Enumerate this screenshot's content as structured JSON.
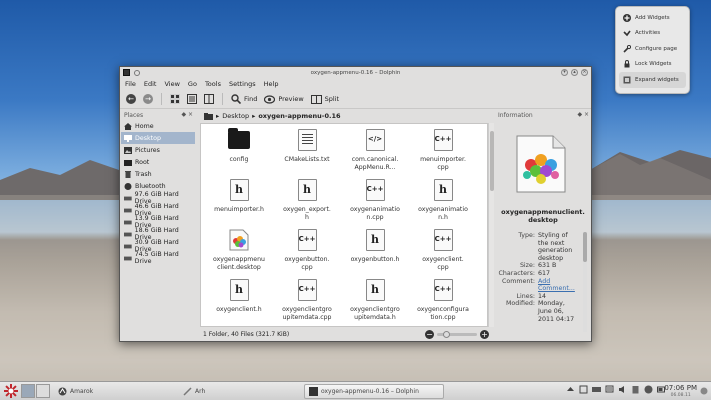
{
  "toolbox": {
    "items": [
      {
        "label": "Add Widgets",
        "icon": "plus-icon"
      },
      {
        "label": "Activities",
        "icon": "activities-icon"
      },
      {
        "label": "Configure page",
        "icon": "wrench-icon"
      },
      {
        "label": "Lock Widgets",
        "icon": "lock-icon"
      },
      {
        "label": "Expand widgets",
        "icon": "expand-icon"
      }
    ]
  },
  "window": {
    "title": "oxygen-appmenu-0.16 – Dolphin",
    "menu": [
      "File",
      "Edit",
      "View",
      "Go",
      "Tools",
      "Settings",
      "Help"
    ],
    "toolbar": {
      "find": "Find",
      "preview": "Preview",
      "split": "Split"
    }
  },
  "places": {
    "header": "Places",
    "items": [
      {
        "label": "Home",
        "icon": "home-icon"
      },
      {
        "label": "Desktop",
        "icon": "desktop-icon"
      },
      {
        "label": "Pictures",
        "icon": "pictures-icon"
      },
      {
        "label": "Root",
        "icon": "root-icon"
      },
      {
        "label": "Trash",
        "icon": "trash-icon"
      },
      {
        "label": "Bluetooth",
        "icon": "bluetooth-icon"
      },
      {
        "label": "97.6 GiB Hard Drive",
        "icon": "harddrive-icon"
      },
      {
        "label": "46.6 GiB Hard Drive",
        "icon": "harddrive-icon"
      },
      {
        "label": "13.9 GiB Hard Drive",
        "icon": "harddrive-icon"
      },
      {
        "label": "18.6 GiB Hard Drive",
        "icon": "harddrive-icon"
      },
      {
        "label": "30.9 GiB Hard Drive",
        "icon": "harddrive-icon"
      },
      {
        "label": "74.5 GiB Hard Drive",
        "icon": "harddrive-icon"
      }
    ]
  },
  "breadcrumb": {
    "parent": "Desktop",
    "current": "oxygen-appmenu-0.16"
  },
  "files": [
    {
      "line1": "config",
      "line2": "",
      "type": "folder"
    },
    {
      "line1": "CMakeLists.txt",
      "line2": "",
      "type": "text"
    },
    {
      "line1": "com.canonical.",
      "line2": "AppMenu.R...",
      "type": "xml"
    },
    {
      "line1": "menuimporter.",
      "line2": "cpp",
      "type": "cpp"
    },
    {
      "line1": "menuimporter.h",
      "line2": "",
      "type": "h"
    },
    {
      "line1": "oxygen_export.",
      "line2": "h",
      "type": "h"
    },
    {
      "line1": "oxygenanimatio",
      "line2": "n.cpp",
      "type": "cpp"
    },
    {
      "line1": "oxygenanimatio",
      "line2": "n.h",
      "type": "h"
    },
    {
      "line1": "oxygenappmenu",
      "line2": "client.desktop",
      "type": "desktop"
    },
    {
      "line1": "oxygenbutton.",
      "line2": "cpp",
      "type": "cpp"
    },
    {
      "line1": "oxygenbutton.h",
      "line2": "",
      "type": "h"
    },
    {
      "line1": "oxygenclient.",
      "line2": "cpp",
      "type": "cpp"
    },
    {
      "line1": "oxygenclient.h",
      "line2": "",
      "type": "h"
    },
    {
      "line1": "oxygenclientgro",
      "line2": "upitemdata.cpp",
      "type": "cpp"
    },
    {
      "line1": "oxygenclientgro",
      "line2": "upitemdata.h",
      "type": "h"
    },
    {
      "line1": "oxygenconfigura",
      "line2": "tion.cpp",
      "type": "cpp"
    }
  ],
  "icon_glyphs": {
    "cpp": "C++",
    "h": "h",
    "xml": "</>"
  },
  "status": {
    "text": "1 Folder, 40 Files (321.7 KiB)"
  },
  "info": {
    "header": "Information",
    "name_line1": "oxygenappmenuclient.",
    "name_line2": "desktop",
    "props": [
      {
        "key": "Type:",
        "lines": [
          "Styling of",
          "the next",
          "generation",
          "desktop"
        ]
      },
      {
        "key": "Size:",
        "lines": [
          "631 B"
        ]
      },
      {
        "key": "Characters:",
        "lines": [
          "617"
        ]
      },
      {
        "key": "Comment:",
        "lines": [
          "Add",
          "Comment..."
        ],
        "link": true
      },
      {
        "key": "Lines:",
        "lines": [
          "14"
        ]
      },
      {
        "key": "Modified:",
        "lines": [
          "Monday,",
          "June 06,",
          "2011 04:17"
        ]
      }
    ]
  },
  "taskbar": {
    "tasks": [
      {
        "label": "Amarok",
        "active": false
      },
      {
        "label": "Arh",
        "active": false
      },
      {
        "label": "oxygen-appmenu-0.16 – Dolphin",
        "active": true
      }
    ],
    "clock": {
      "time": "07:06 PM",
      "date": "06.08.11"
    }
  },
  "colors": {
    "selection": "#a3b5cc",
    "link": "#3a6fb0",
    "kmenu": "#c0262c"
  }
}
